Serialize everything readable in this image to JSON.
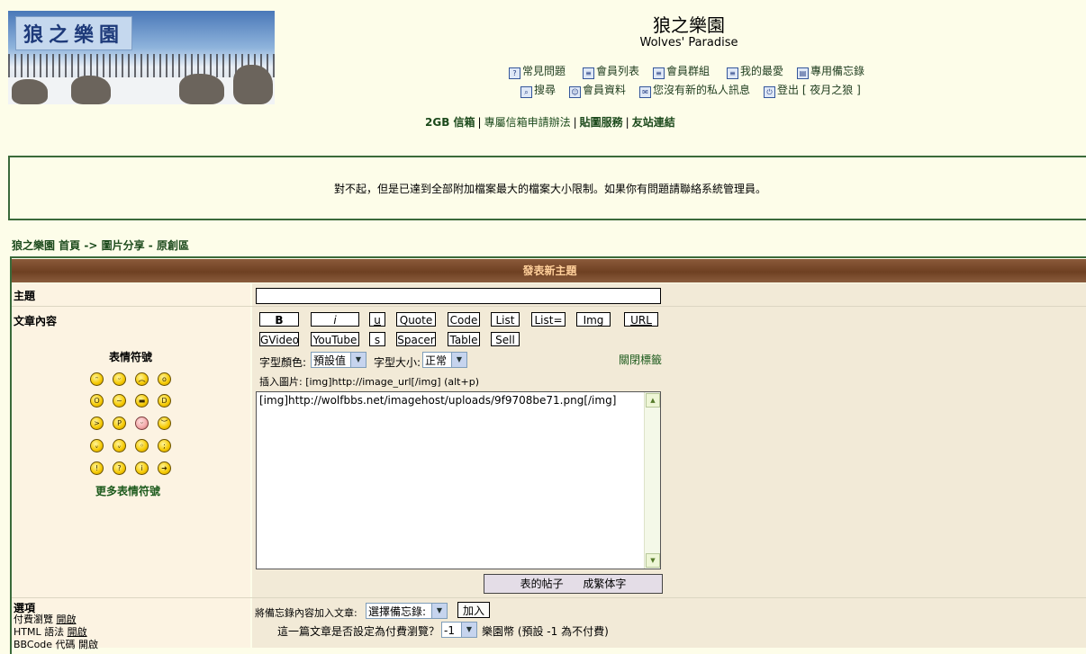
{
  "header": {
    "logo_text": "狼之樂園",
    "site_title": "狼之樂園",
    "site_subtitle": "Wolves' Paradise",
    "nav_row1": [
      {
        "icon": "faq-icon",
        "label": "常見問題"
      },
      {
        "icon": "memberlist-icon",
        "label": "會員列表"
      },
      {
        "icon": "groups-icon",
        "label": "會員群組"
      },
      {
        "icon": "favorites-icon",
        "label": "我的最愛"
      },
      {
        "icon": "notepad-icon",
        "label": "專用備忘錄"
      }
    ],
    "nav_row2": [
      {
        "icon": "search-icon",
        "label": "搜尋"
      },
      {
        "icon": "profile-icon",
        "label": "會員資料"
      },
      {
        "icon": "message-icon",
        "label": "您沒有新的私人訊息"
      },
      {
        "icon": "logout-icon",
        "label": "登出 [ 夜月之狼 ]"
      }
    ],
    "links": [
      "2GB 信箱",
      "專屬信箱申請辦法",
      "貼圖服務",
      "友站連結"
    ]
  },
  "notice": "對不起，但是已達到全部附加檔案最大的檔案大小限制。如果你有問題請聯絡系統管理員。",
  "breadcrumb": {
    "home": "狼之樂園 首頁",
    "arrow": "->",
    "forum": "圖片分享 - 原創區"
  },
  "form": {
    "header": "發表新主題",
    "subject_label": "主題",
    "subject_value": "",
    "content_label": "文章內容",
    "smilies_title": "表情符號",
    "more_smilies": "更多表情符號",
    "buttons_row1": [
      "B",
      "i",
      "u",
      "Quote",
      "Code",
      "List",
      "List=",
      "Img",
      "URL"
    ],
    "buttons_row2": [
      "GVideo",
      "YouTube",
      "s",
      "Spacer",
      "Table",
      "Sell"
    ],
    "font_color_label": "字型顏色:",
    "font_color_value": "預設值",
    "font_size_label": "字型大小:",
    "font_size_value": "正常",
    "close_tags": "關閉標籤",
    "hint": "插入圖片: [img]http://image_url[/img]  (alt+p)",
    "textarea_value": "[img]http://wolfbbs.net/imagehost/uploads/9f9708be71.png[/img]",
    "preview_button": "表的帖子 成繁体字",
    "options_label": "選項",
    "option_paid_label": "付費瀏覽",
    "option_paid_state": "開啟",
    "option_html_label": "HTML 語法",
    "option_html_state": "開啟",
    "option_bbcode_partial": "BBCode 代碼 開啟",
    "memo_label": "將備忘錄內容加入文章:",
    "memo_select": "選擇備忘錄:",
    "add_button": "加入",
    "paid_question": "這一篇文章是否設定為付費瀏覽？",
    "paid_value": "-1",
    "paid_hint": "樂園幣 (預設 -1 為不付費)"
  }
}
